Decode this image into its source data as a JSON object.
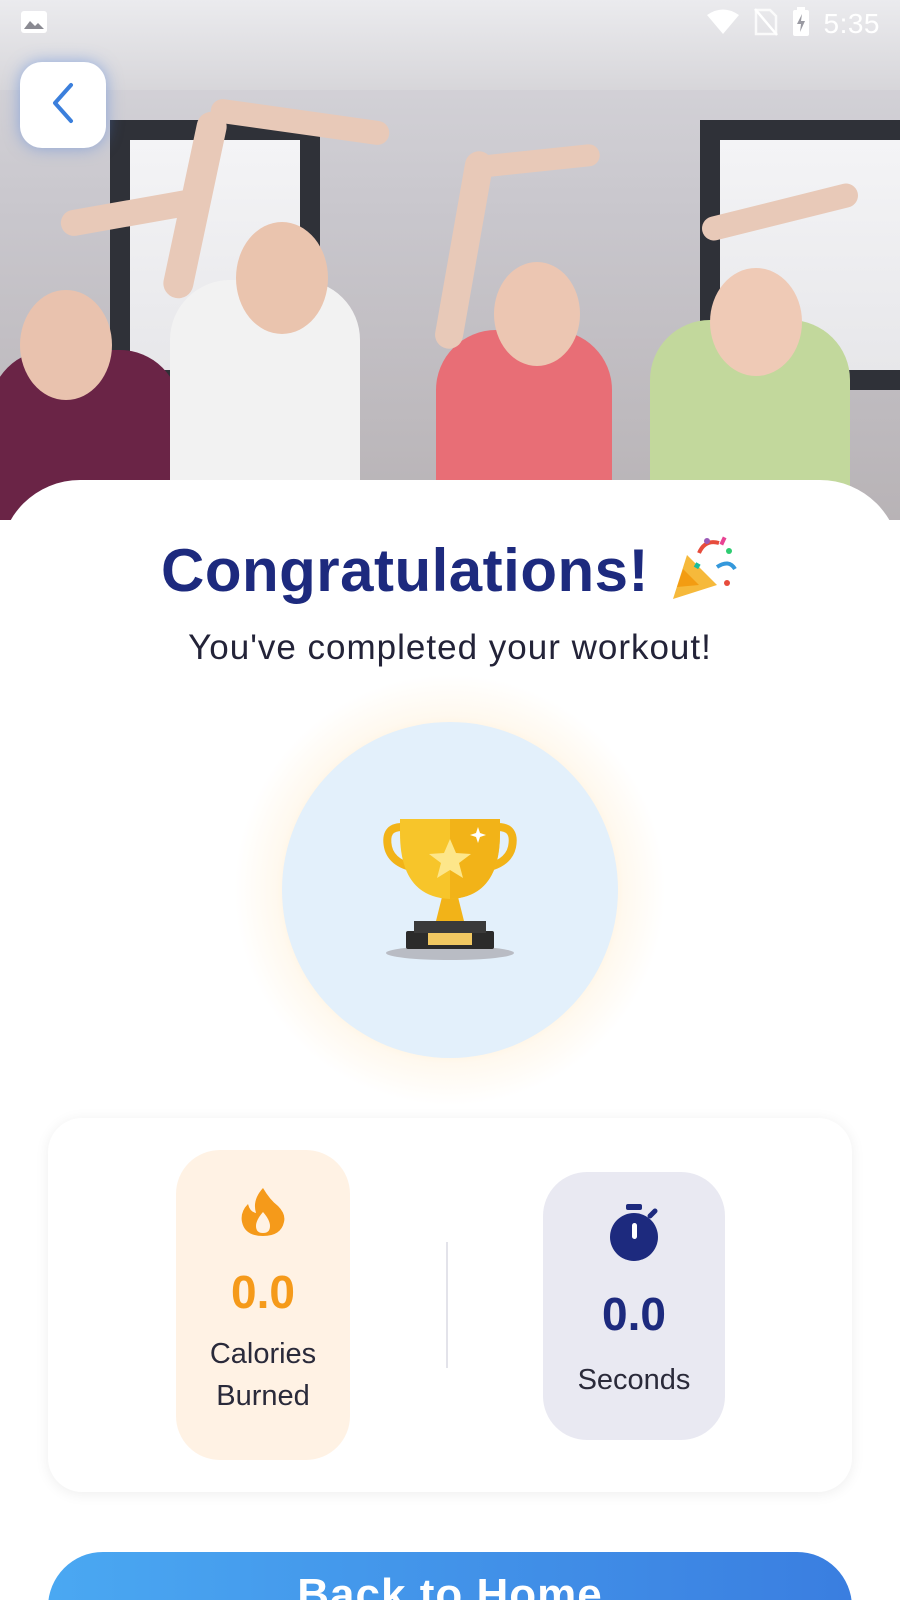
{
  "status_bar": {
    "time": "5:35",
    "icons": [
      "image-icon",
      "wifi-icon",
      "no-sim-icon",
      "battery-charging-icon"
    ]
  },
  "header": {
    "back_icon": "chevron-left-icon"
  },
  "hero": {
    "image_subject": "seniors stretching"
  },
  "congrats": {
    "title": "Congratulations!",
    "title_emoji": "party-popper-icon",
    "subtitle": "You've completed your workout!",
    "badge_icon": "trophy-icon"
  },
  "stats": {
    "calories": {
      "icon": "fire-icon",
      "value": "0.0",
      "label_line1": "Calories",
      "label_line2": "Burned",
      "color": "#f59a1a"
    },
    "seconds": {
      "icon": "stopwatch-icon",
      "value": "0.0",
      "label": "Seconds",
      "color": "#1d2a7e"
    }
  },
  "actions": {
    "back_home_label": "Back to Home"
  },
  "colors": {
    "primary": "#1d2a7e",
    "accent_orange": "#f59a1a",
    "button_blue": "#3a8ce8",
    "circle_bg": "#e3f0fb"
  }
}
